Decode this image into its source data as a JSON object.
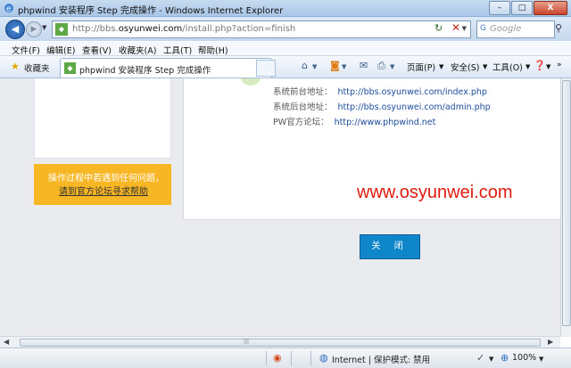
{
  "window": {
    "title": "phpwind 安装程序 Step 完成操作 - Windows Internet Explorer",
    "controls": [
      "–",
      "□",
      "X"
    ]
  },
  "nav": {
    "url_prefix": "http://bbs.",
    "url_domain": "osyunwei.com",
    "url_rest": "/install.php?action=finish",
    "search_placeholder": "Google"
  },
  "menu": {
    "items": [
      "文件(F)",
      "编辑(E)",
      "查看(V)",
      "收藏夹(A)",
      "工具(T)",
      "帮助(H)"
    ]
  },
  "command_bar": {
    "favorites_label": "收藏夹",
    "tab_title": "phpwind 安装程序 Step 完成操作",
    "page_label": "页面(P)",
    "safety_label": "安全(S)",
    "tools_label": "工具(O)"
  },
  "content": {
    "rows": [
      {
        "key": "系统前台地址：",
        "value": "http://bbs.osyunwei.com/index.php"
      },
      {
        "key": "系统后台地址：",
        "value": "http://bbs.osyunwei.com/admin.php"
      },
      {
        "key": "PW官方论坛：",
        "value": "http://www.phpwind.net"
      }
    ],
    "help_line1": "操作过程中若遇到任何问题，",
    "help_line2": "请到官方论坛寻求帮助",
    "watermark": "www.osyunwei.com",
    "close_button": "关 闭"
  },
  "status": {
    "zone_text": "Internet | 保护模式: 禁用",
    "zoom": "100%"
  }
}
